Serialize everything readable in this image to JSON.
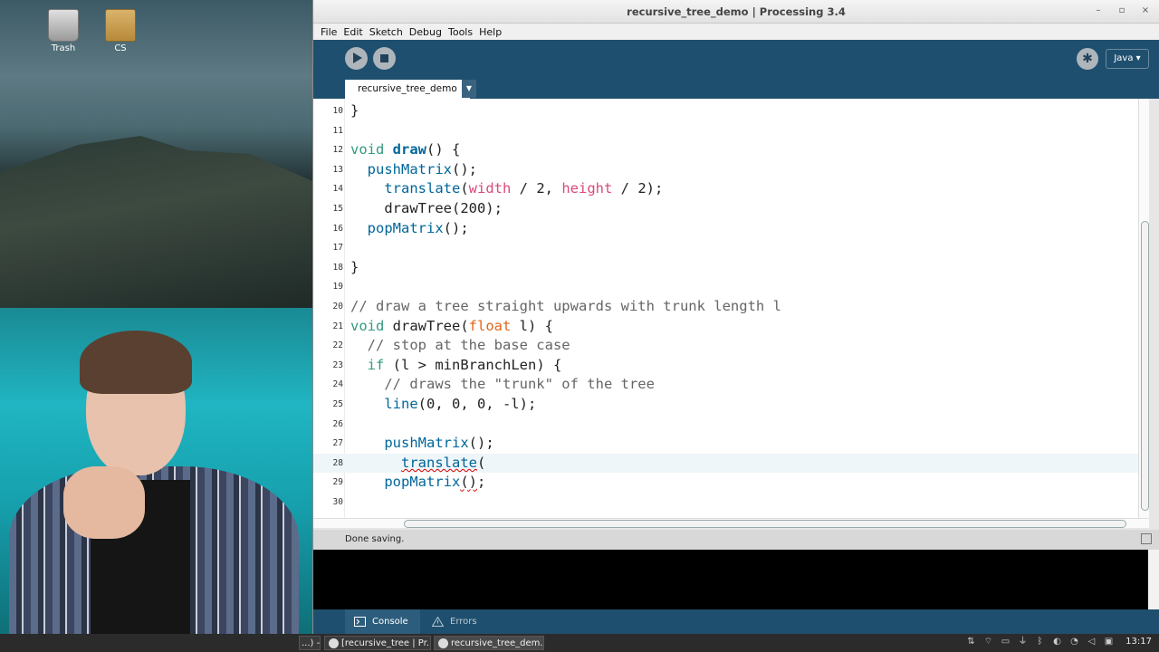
{
  "desktop": {
    "icons": [
      {
        "name": "trash",
        "label": "Trash"
      },
      {
        "name": "folder",
        "label": "CS"
      }
    ]
  },
  "window": {
    "title": "recursive_tree_demo | Processing 3.4",
    "controls": {
      "minimize": "–",
      "maximize": "▫",
      "close": "×"
    }
  },
  "menu": [
    "File",
    "Edit",
    "Sketch",
    "Debug",
    "Tools",
    "Help"
  ],
  "toolbar": {
    "play_icon": "play-icon",
    "stop_icon": "stop-icon",
    "debug_icon": "butterfly-icon",
    "mode": "Java ▾"
  },
  "tabs": [
    {
      "label": "recursive_tree_demo",
      "active": true
    }
  ],
  "editor": {
    "current_line": 28,
    "lines": [
      {
        "n": "10",
        "segs": [
          {
            "t": "}",
            "c": ""
          }
        ]
      },
      {
        "n": "11",
        "segs": []
      },
      {
        "n": "12",
        "segs": [
          {
            "t": "void ",
            "c": "kw"
          },
          {
            "t": "draw",
            "c": "fn"
          },
          {
            "t": "() {",
            "c": ""
          }
        ]
      },
      {
        "n": "13",
        "segs": [
          {
            "t": "  ",
            "c": ""
          },
          {
            "t": "pushMatrix",
            "c": "fn2"
          },
          {
            "t": "();",
            "c": ""
          }
        ]
      },
      {
        "n": "14",
        "segs": [
          {
            "t": "    ",
            "c": ""
          },
          {
            "t": "translate",
            "c": "fn2"
          },
          {
            "t": "(",
            "c": ""
          },
          {
            "t": "width",
            "c": "var"
          },
          {
            "t": " / 2, ",
            "c": ""
          },
          {
            "t": "height",
            "c": "var"
          },
          {
            "t": " / 2);",
            "c": ""
          }
        ]
      },
      {
        "n": "15",
        "segs": [
          {
            "t": "    drawTree(200);",
            "c": ""
          }
        ]
      },
      {
        "n": "16",
        "segs": [
          {
            "t": "  ",
            "c": ""
          },
          {
            "t": "popMatrix",
            "c": "fn2"
          },
          {
            "t": "();",
            "c": ""
          }
        ]
      },
      {
        "n": "17",
        "segs": []
      },
      {
        "n": "18",
        "segs": [
          {
            "t": "}",
            "c": ""
          }
        ]
      },
      {
        "n": "19",
        "segs": []
      },
      {
        "n": "20",
        "segs": [
          {
            "t": "// draw a tree straight upwards with trunk length l",
            "c": "cm"
          }
        ]
      },
      {
        "n": "21",
        "segs": [
          {
            "t": "void ",
            "c": "kw"
          },
          {
            "t": "drawTree(",
            "c": ""
          },
          {
            "t": "float",
            "c": "ty"
          },
          {
            "t": " l) {",
            "c": ""
          }
        ]
      },
      {
        "n": "22",
        "segs": [
          {
            "t": "  // stop at the base case",
            "c": "cm"
          }
        ]
      },
      {
        "n": "23",
        "segs": [
          {
            "t": "  ",
            "c": ""
          },
          {
            "t": "if",
            "c": "kw"
          },
          {
            "t": " (l > minBranchLen) {",
            "c": ""
          }
        ]
      },
      {
        "n": "24",
        "segs": [
          {
            "t": "    // draws the \"trunk\" of the tree",
            "c": "cm"
          }
        ]
      },
      {
        "n": "25",
        "segs": [
          {
            "t": "    ",
            "c": ""
          },
          {
            "t": "line",
            "c": "fn2"
          },
          {
            "t": "(0, 0, 0, -l);",
            "c": ""
          }
        ]
      },
      {
        "n": "26",
        "segs": []
      },
      {
        "n": "27",
        "segs": [
          {
            "t": "    ",
            "c": ""
          },
          {
            "t": "pushMatrix",
            "c": "fn2"
          },
          {
            "t": "();",
            "c": ""
          }
        ]
      },
      {
        "n": "28",
        "segs": [
          {
            "t": "      ",
            "c": ""
          },
          {
            "t": "translate",
            "c": "fn2 sq"
          },
          {
            "t": "(",
            "c": ""
          }
        ]
      },
      {
        "n": "29",
        "segs": [
          {
            "t": "    ",
            "c": ""
          },
          {
            "t": "popMatrix",
            "c": "fn2"
          },
          {
            "t": "()",
            "c": "sq"
          },
          {
            "t": ";",
            "c": ""
          }
        ]
      },
      {
        "n": "30",
        "segs": []
      }
    ]
  },
  "status": {
    "message": "Done saving."
  },
  "console_tabs": [
    {
      "label": "Console",
      "icon": "console-icon",
      "active": true
    },
    {
      "label": "Errors",
      "icon": "warning-icon",
      "active": false
    }
  ],
  "taskbar": {
    "tasks": [
      {
        "label": "...) - ..."
      },
      {
        "label": "[recursive_tree | Pr..."
      },
      {
        "label": "recursive_tree_dem..."
      }
    ],
    "tray_icons": [
      "network-icon",
      "wifi-icon",
      "storage-icon",
      "usb-icon",
      "bluetooth-icon",
      "color-icon",
      "speech-icon",
      "volume-icon",
      "display-icon"
    ],
    "clock": "13:17"
  },
  "colors": {
    "toolbar": "#1f4f6e",
    "keyword": "#33997e",
    "function": "#006699",
    "builtin_var": "#d94a7a",
    "type": "#e2661a",
    "comment": "#666666"
  }
}
